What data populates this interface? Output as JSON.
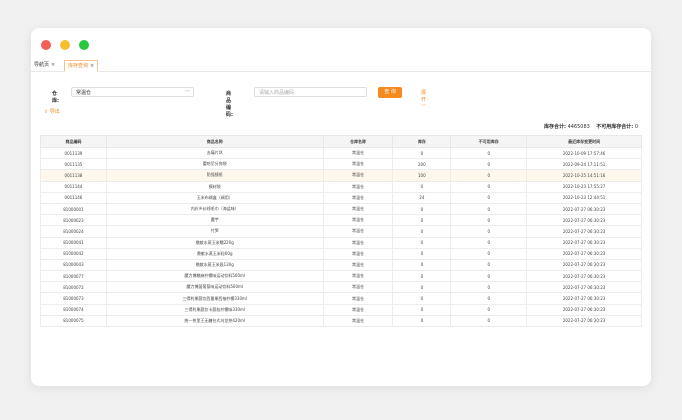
{
  "tabs": [
    {
      "label": "导航页",
      "close": "×"
    },
    {
      "label": "库存查询",
      "close": "×"
    }
  ],
  "filters": {
    "warehouse_label": "仓库:",
    "warehouse_value": "常温仓",
    "product_label": "商品编码:",
    "product_placeholder": "请输入商品编码",
    "query_button": "查 询",
    "expand_label": "展开 ﹀"
  },
  "export_label": "导出",
  "summary": {
    "total_label": "库存合计:",
    "total_value": "4465083",
    "unavailable_label": "不可用库存合计:",
    "unavailable_value": "0"
  },
  "table": {
    "headers": [
      "商品编码",
      "商品名称",
      "仓库名称",
      "库存",
      "不可用库存",
      "最近库存变更时间"
    ],
    "rows": [
      [
        "0011139",
        "去痛片IX",
        "常温仓",
        "0",
        "0",
        "2022-10-09 17:57:46"
      ],
      [
        "0011135",
        "蕾哈尼分饰袋",
        "常温仓",
        "200",
        "0",
        "2022-09-24 17:11:51"
      ],
      [
        "0011138",
        "防弧镜纸",
        "常温仓",
        "100",
        "0",
        "2022-10-25 14:51:16"
      ],
      [
        "0011144",
        "模材袋",
        "常温仓",
        "0",
        "0",
        "2022-10-23 17:55:27"
      ],
      [
        "0011146",
        "玉米布绸盒（绸用）",
        "常温仓",
        "24",
        "0",
        "2022-10-23 12:44:51"
      ],
      [
        "81000001",
        "内衫乡纱线毛巾（海盐味）",
        "常温仓",
        "0",
        "0",
        "2022-07-27 06:30:23"
      ],
      [
        "81000023",
        "魔芋",
        "常温仓",
        "0",
        "0",
        "2022-07-27 06:30:23"
      ],
      [
        "81000024",
        "竹笋",
        "常温仓",
        "0",
        "0",
        "2022-07-27 06:30:23"
      ],
      [
        "81000041",
        "鼎献水蒸玉米糯220g",
        "常温仓",
        "0",
        "0",
        "2022-07-27 06:30:23"
      ],
      [
        "81000042",
        "鼎献水蒸玉米粒60g",
        "常温仓",
        "0",
        "0",
        "2022-07-27 06:30:23"
      ],
      [
        "81000043",
        "鼎献水蒸玉米段130g",
        "常温仓",
        "0",
        "0",
        "2022-07-27 06:30:23"
      ],
      [
        "81000077",
        "魔力博粮麻柠檬味运动饮料500ml",
        "常温仓",
        "0",
        "0",
        "2022-07-27 06:30:23"
      ],
      [
        "81000072",
        "魔力博菌葡萄味运动饮料500ml",
        "常温仓",
        "0",
        "0",
        "2022-07-27 06:30:23"
      ],
      [
        "81000073",
        "三得利果蔬饮西番果西柚柠檬330ml",
        "常温仓",
        "0",
        "0",
        "2022-07-27 06:30:23"
      ],
      [
        "81000074",
        "三得利果蔬饮卡蔬桂柠檬味330ml",
        "常温仓",
        "0",
        "0",
        "2022-07-27 06:30:23"
      ],
      [
        "81000075",
        "统一茶里王无糖台式乌龙茶420ml",
        "常温仓",
        "0",
        "0",
        "2022-07-27 06:30:23"
      ]
    ]
  }
}
